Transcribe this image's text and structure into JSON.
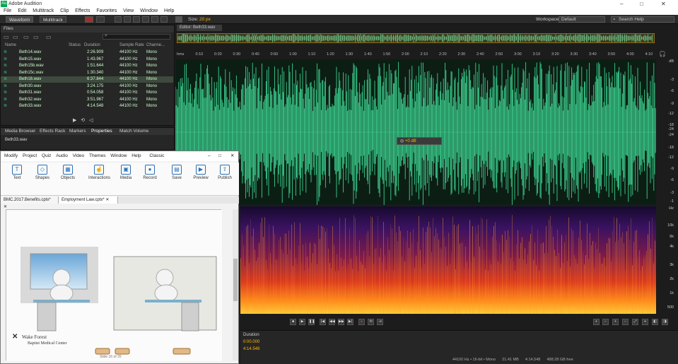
{
  "titlebar": {
    "app_title": "Adobe Audition",
    "controls": [
      "–",
      "□",
      "✕"
    ]
  },
  "menu": [
    "File",
    "Edit",
    "Multitrack",
    "Clip",
    "Effects",
    "Favorites",
    "View",
    "Window",
    "Help"
  ],
  "toolbar": {
    "waveform": "Waveform",
    "multitrack": "Multitrack",
    "size_label": "Size:",
    "size_value": "20 px",
    "workspace_label": "Workspace:",
    "workspace_value": "Default",
    "search": "Search Help"
  },
  "files": {
    "tab": "Files",
    "headers": [
      "Name",
      "Status",
      "Duration",
      "Sample Rate",
      "Channe..."
    ],
    "rows": [
      {
        "name": "Beth14.wav",
        "duration": "2:26.909",
        "rate": "44100 Hz",
        "ch": "Mono"
      },
      {
        "name": "Beth15.wav",
        "duration": "1:43.967",
        "rate": "44100 Hz",
        "ch": "Mono"
      },
      {
        "name": "Beth15b.wav",
        "duration": "1:51.644",
        "rate": "44100 Hz",
        "ch": "Mono"
      },
      {
        "name": "Beth15c.wav",
        "duration": "1:30.340",
        "rate": "44100 Hz",
        "ch": "Mono"
      },
      {
        "name": "Beth16.wav",
        "duration": "6:37.844",
        "rate": "44100 Hz",
        "ch": "Mono"
      },
      {
        "name": "Beth30.wav",
        "duration": "3:24.175",
        "rate": "44100 Hz",
        "ch": "Mono"
      },
      {
        "name": "Beth31.wav",
        "duration": "0:54.058",
        "rate": "44100 Hz",
        "ch": "Mono"
      },
      {
        "name": "Beth32.wav",
        "duration": "3:51.967",
        "rate": "44100 Hz",
        "ch": "Mono"
      },
      {
        "name": "Beth33.wav",
        "duration": "4:14.548",
        "rate": "44100 Hz",
        "ch": "Mono"
      }
    ]
  },
  "lower_tabs": [
    "Media Browser",
    "Effects Rack",
    "Markers",
    "Properties",
    "Match Volume"
  ],
  "properties_file": "Beth33.wav",
  "captivate": {
    "menu": [
      "Modify",
      "Project",
      "Quiz",
      "Audio",
      "Video",
      "Themes",
      "Window",
      "Help"
    ],
    "mode": "Classic",
    "tools": [
      {
        "label": "Text",
        "icon": "T"
      },
      {
        "label": "Shapes",
        "icon": "◇"
      },
      {
        "label": "Objects",
        "icon": "▦"
      },
      {
        "label": "Interactions",
        "icon": "☝"
      },
      {
        "label": "Media",
        "icon": "▣"
      },
      {
        "label": "Record",
        "icon": "●"
      },
      {
        "label": "Save",
        "icon": "▤"
      },
      {
        "label": "Preview",
        "icon": "▶"
      },
      {
        "label": "Publish",
        "icon": "⇧"
      }
    ],
    "tabs": [
      "BMC.2017.Benefits.cptx*",
      "Employment Law.cptx*"
    ],
    "logo_line1": "Wake Forest",
    "logo_line2": "Baptist Medical Center",
    "slide_counter": "Slide 16 of 20"
  },
  "editor": {
    "tab": "Editor: Beth33.wav",
    "ruler": [
      "hms",
      "0:10",
      "0:20",
      "0:30",
      "0:40",
      "0:50",
      "1:00",
      "1:10",
      "1:20",
      "1:30",
      "1:40",
      "1:50",
      "2:00",
      "2:10",
      "2:20",
      "2:30",
      "2:40",
      "2:50",
      "3:00",
      "3:10",
      "3:20",
      "3:30",
      "3:40",
      "3:50",
      "4:00",
      "4:10"
    ],
    "db_labels": [
      "dB",
      "-3",
      "-6",
      "-9",
      "-12",
      "-18",
      "-24",
      "-24",
      "-18",
      "-12",
      "-9",
      "-6",
      "-3",
      "-1"
    ],
    "hz_labels": [
      "Hz",
      "10k",
      "6k",
      "4k",
      "3k",
      "2k",
      "1k",
      "500"
    ],
    "hud_db": "+0 dB",
    "duration_label": "Duration",
    "duration_values": [
      "0:00.000",
      "4:14.548"
    ],
    "status": "44100 Hz • 16-bit • Mono      21.41 MB      4:14.548      488.28 GB free"
  },
  "colors": {
    "wave": "#3ccf8e",
    "accent": "#ffb400"
  }
}
